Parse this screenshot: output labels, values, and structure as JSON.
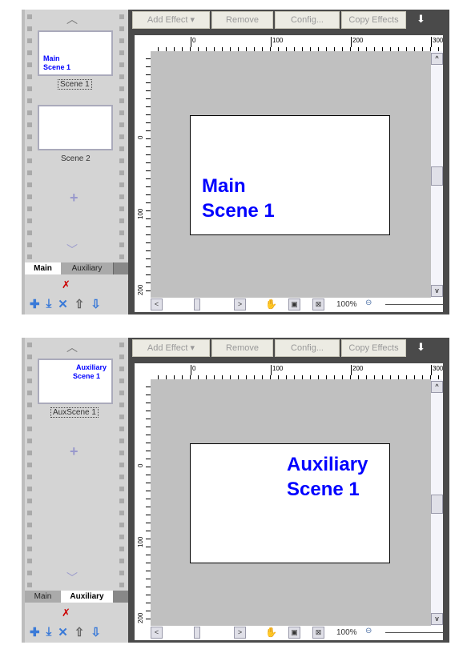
{
  "toolbar": {
    "add_effect": "Add Effect",
    "remove": "Remove",
    "config": "Config...",
    "copy_effects": "Copy Effects"
  },
  "ruler": {
    "top": [
      "0",
      "100",
      "200",
      "300"
    ],
    "left": [
      "0",
      "100",
      "200"
    ]
  },
  "tabs": {
    "main": "Main",
    "auxiliary": "Auxiliary"
  },
  "zoom": "100%",
  "panel1": {
    "thumb1_text": "Main\nScene 1",
    "thumb1_label": "Scene 1",
    "thumb2_label": "Scene 2",
    "page_line1": "Main",
    "page_line2": "Scene 1",
    "active_tab": "Main"
  },
  "panel2": {
    "thumb1_line1": "Auxiliary",
    "thumb1_line2": "Scene 1",
    "thumb1_label": "AuxScene 1",
    "page_line1": "Auxiliary",
    "page_line2": "Scene 1",
    "active_tab": "Auxiliary"
  },
  "icons": [
    "add-icon",
    "import-icon",
    "delete-icon",
    "move-up-icon",
    "move-down-icon",
    "no-effect-icon",
    "hand-icon",
    "fit-icon",
    "actual-size-icon",
    "zoom-out-icon"
  ]
}
